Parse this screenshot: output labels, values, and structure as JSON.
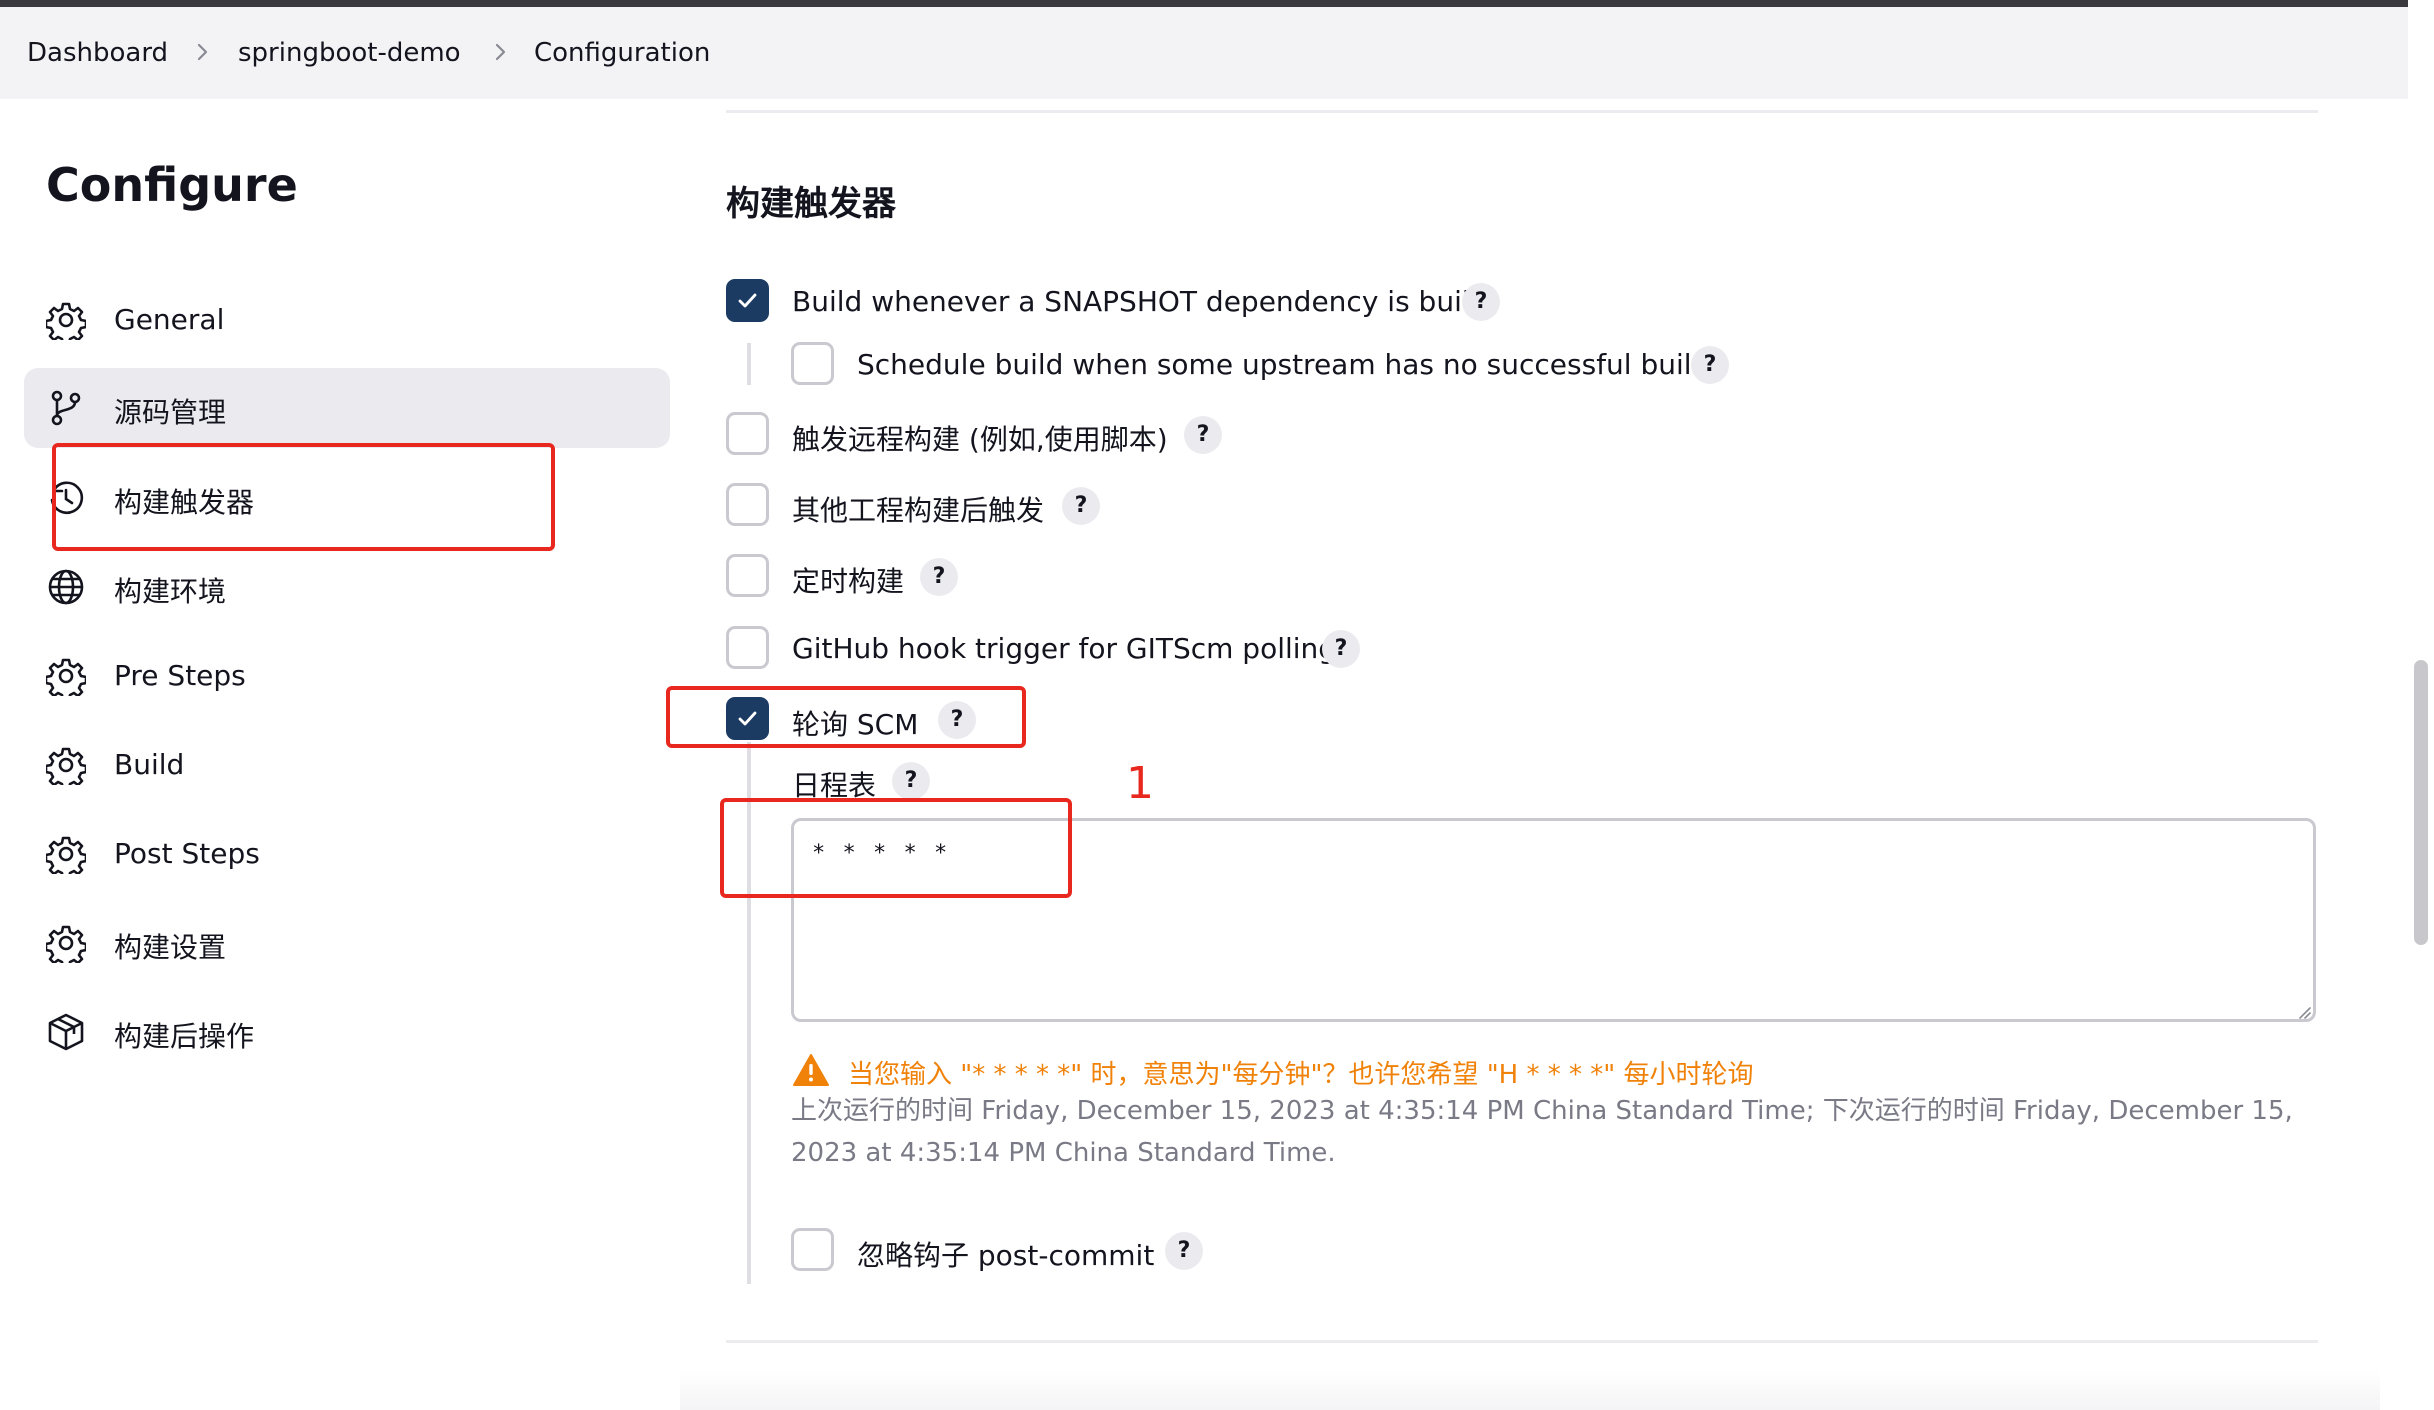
{
  "breadcrumb": {
    "items": [
      "Dashboard",
      "springboot-demo",
      "Configuration"
    ]
  },
  "sidebar": {
    "title": "Configure",
    "active_index": 1,
    "items": [
      {
        "label": "General",
        "icon": "gear-icon"
      },
      {
        "label": "源码管理",
        "icon": "git-branch-icon"
      },
      {
        "label": "构建触发器",
        "icon": "clock-history-icon"
      },
      {
        "label": "构建环境",
        "icon": "globe-icon"
      },
      {
        "label": "Pre Steps",
        "icon": "gear-icon"
      },
      {
        "label": "Build",
        "icon": "gear-icon"
      },
      {
        "label": "Post Steps",
        "icon": "gear-icon"
      },
      {
        "label": "构建设置",
        "icon": "gear-icon"
      },
      {
        "label": "构建后操作",
        "icon": "package-icon"
      }
    ]
  },
  "section": {
    "title": "构建触发器"
  },
  "triggers": {
    "snapshot": {
      "label": "Build whenever a SNAPSHOT dependency is built",
      "checked": true
    },
    "upstream": {
      "label": "Schedule build when some upstream has no successful builds",
      "checked": false
    },
    "remote": {
      "label": "触发远程构建 (例如,使用脚本)",
      "checked": false
    },
    "after_other": {
      "label": "其他工程构建后触发",
      "checked": false
    },
    "periodic": {
      "label": "定时构建",
      "checked": false
    },
    "github_hook": {
      "label": "GitHub hook trigger for GITScm polling",
      "checked": false
    },
    "poll_scm": {
      "label": "轮询 SCM",
      "checked": true
    },
    "ignore_post_commit": {
      "label": "忽略钩子 post-commit",
      "checked": false
    }
  },
  "help_label": "?",
  "schedule": {
    "label": "日程表",
    "value": "* * * * *",
    "warning": "当您输入 \"* * * * *\" 时，意思为\"每分钟\"？也许您希望 \"H * * * *\" 每小时轮询",
    "info": "上次运行的时间 Friday, December 15, 2023 at 4:35:14 PM China Standard Time; 下次运行的时间 Friday, December 15, 2023 at 4:35:14 PM China Standard Time."
  },
  "annotation": {
    "number": "1"
  },
  "colors": {
    "accent": "#1c3b63",
    "highlight_box": "#e8281e",
    "warning": "#f0820a",
    "muted_text": "#7a7a86",
    "active_nav_bg": "#ebebef"
  }
}
